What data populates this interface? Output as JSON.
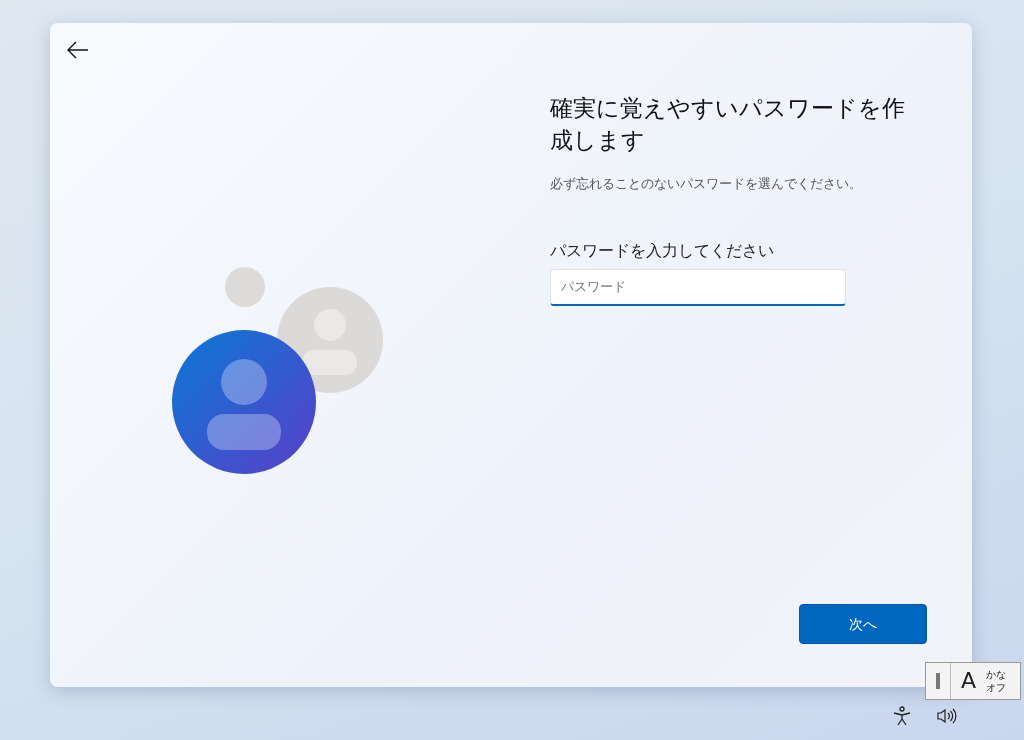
{
  "dialog": {
    "title": "確実に覚えやすいパスワードを作成します",
    "subtitle": "必ず忘れることのないパスワードを選んでください。",
    "field_label": "パスワードを入力してください",
    "password_field": {
      "placeholder": "パスワード"
    },
    "next_button": "次へ"
  },
  "ime_indicator": {
    "mode": "A",
    "kana_line_1": "かな",
    "kana_line_2": "オフ"
  }
}
